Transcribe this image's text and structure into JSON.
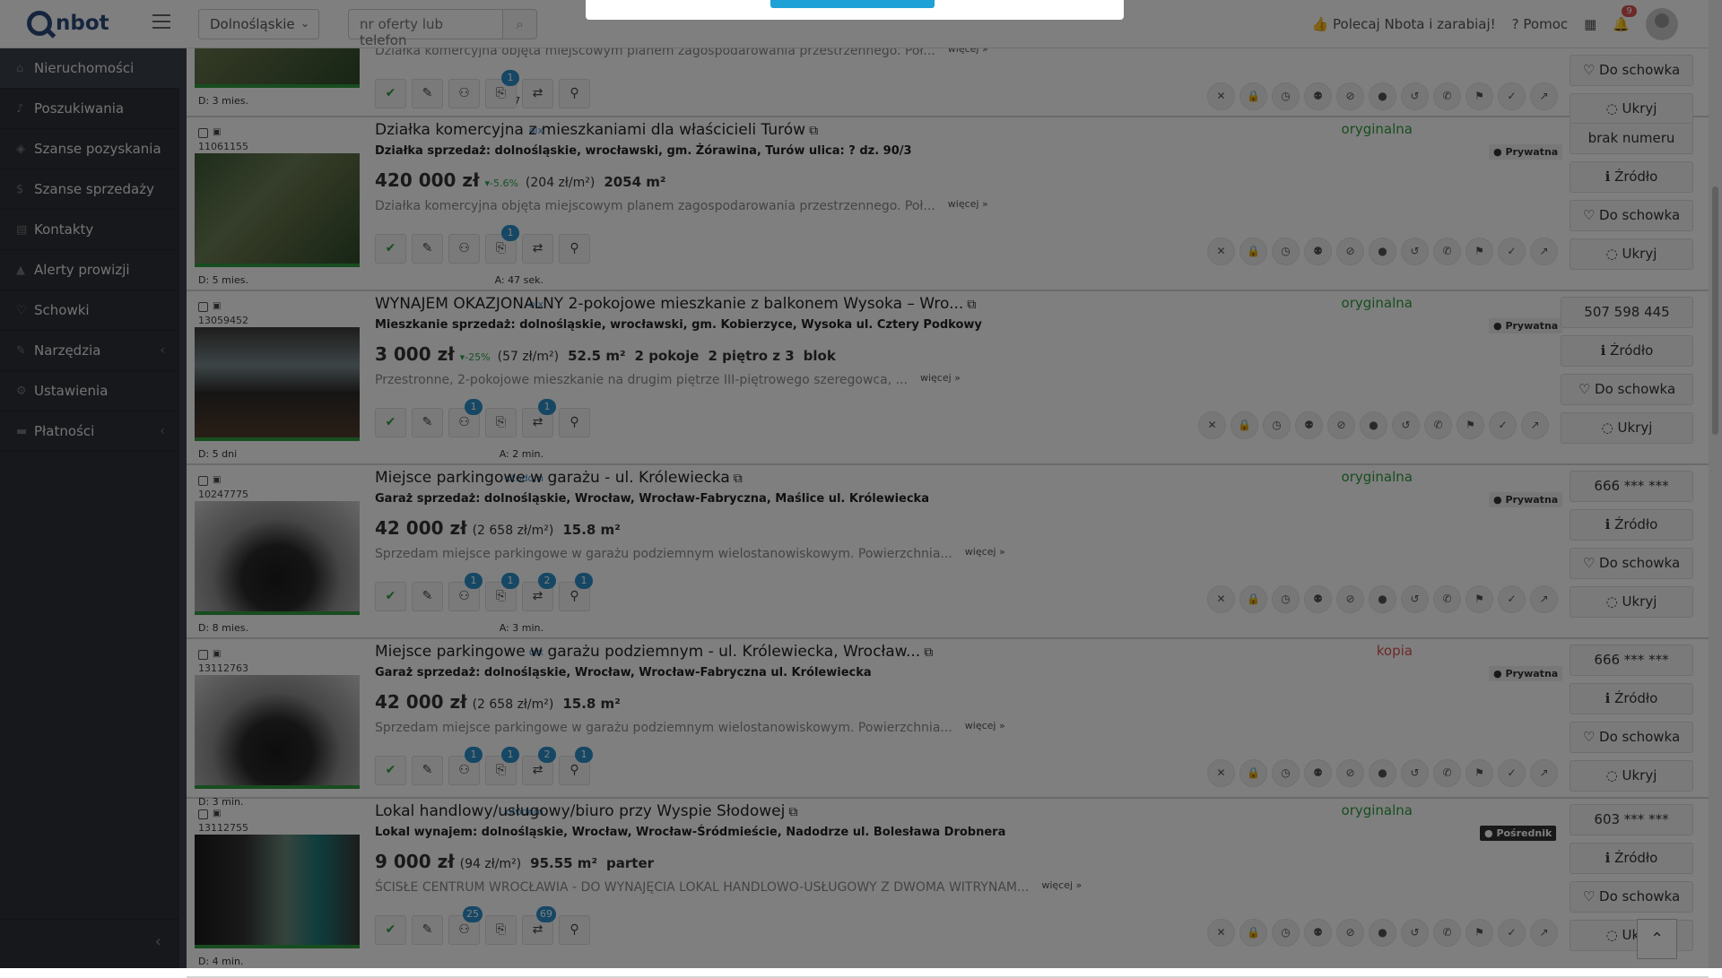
{
  "topbar": {
    "logo": "nbot",
    "region": "Dolnośląskie",
    "search_placeholder": "nr oferty lub telefon",
    "recommend": "Polecaj Nbota i zarabiaj!",
    "help": "Pomoc",
    "notifications": "9"
  },
  "sidebar": {
    "items": [
      {
        "label": "Nieruchomości",
        "icon": "home-icon"
      },
      {
        "label": "Poszukiwania",
        "icon": "bell-icon"
      },
      {
        "label": "Szanse pozyskania",
        "icon": "handshake-icon"
      },
      {
        "label": "Szanse sprzedaży",
        "icon": "dollar-icon"
      },
      {
        "label": "Kontakty",
        "icon": "contact-icon"
      },
      {
        "label": "Alerty prowizji",
        "icon": "warning-icon"
      },
      {
        "label": "Schowki",
        "icon": "heart-icon"
      },
      {
        "label": "Narzędzia",
        "icon": "wrench-icon"
      },
      {
        "label": "Ustawienia",
        "icon": "gear-icon"
      },
      {
        "label": "Płatności",
        "icon": "cart-icon"
      }
    ]
  },
  "common": {
    "source_btn": "Źródło",
    "clipboard_btn": "Do schowka",
    "hide_btn": "Ukryj",
    "more": "więcej »",
    "private": "Prywatna",
    "agent": "Pośrednik"
  },
  "listings": [
    {
      "id": "",
      "source": "",
      "age_d": "D: 3 mies.",
      "age_a": "A: 47 sek.",
      "title": "",
      "sub": "",
      "desc": "Działka komercyjna objęta miejscowym planem zagospodarowania przestrzennego. Poł...",
      "price": "",
      "change": "",
      "ppm": "",
      "area": "",
      "extra": [],
      "status": "",
      "owner": "",
      "phone": "",
      "counts": [
        "",
        "",
        "",
        "1",
        "",
        ""
      ]
    },
    {
      "id": "11061155",
      "source": "olx",
      "age_d": "D: 5 mies.",
      "age_a": "A: 47 sek.",
      "title": "Działka komercyjna z mieszkaniami dla właścicieli Turów",
      "sub": "Działka sprzedaż: dolnośląskie, wrocławski, gm. Żórawina, Turów ulica: ? dz. 90/3",
      "price": "420 000 zł",
      "change": "▾-5.6%",
      "ppm": "(204 zł/m²)",
      "area": "2054 m²",
      "extra": [],
      "desc": "Działka komercyjna objęta miejscowym planem zagospodarowania przestrzennego. Poł...",
      "status": "oryginalna",
      "owner": "Prywatna",
      "phone": "brak numeru",
      "counts": [
        "",
        "",
        "",
        "1",
        "",
        ""
      ]
    },
    {
      "id": "13059452",
      "source": "olx",
      "age_d": "D: 5 dni",
      "age_a": "A: 2 min.",
      "title": "WYNAJEM OKAZJONALNY 2-pokojowe mieszkanie z balkonem Wysoka – Wro...",
      "sub": "Mieszkanie sprzedaż: dolnośląskie, wrocławski, gm. Kobierzyce, Wysoka ul. Cztery Podkowy",
      "price": "3 000 zł",
      "change": "▾-25%",
      "ppm": "(57 zł/m²)",
      "area": "52.5 m²",
      "extra": [
        "2 pokoje",
        "2 piętro z 3",
        "blok"
      ],
      "desc": "Przestronne, 2-pokojowe mieszkanie na drugim piętrze III-piętrowego szeregowca, ...",
      "status": "oryginalna",
      "owner": "Prywatna",
      "phone": "507 598 445",
      "counts": [
        "",
        "",
        "1",
        "",
        "1",
        ""
      ]
    },
    {
      "id": "10247775",
      "source": "otodom",
      "age_d": "D: 8 mies.",
      "age_a": "A: 3 min.",
      "title": "Miejsce parkingowe w garażu - ul. Królewiecka",
      "sub": "Garaż sprzedaż: dolnośląskie, Wrocław, Wrocław-Fabryczna, Maślice ul. Królewiecka",
      "price": "42 000 zł",
      "change": "",
      "ppm": "(2 658 zł/m²)",
      "area": "15.8 m²",
      "extra": [],
      "desc": "Sprzedam miejsce parkingowe w garażu podziemnym wielostanowiskowym. Powierzchnia...",
      "status": "oryginalna",
      "owner": "Prywatna",
      "phone": "666 *** ***",
      "counts": [
        "",
        "",
        "1",
        "1",
        "2",
        "1"
      ]
    },
    {
      "id": "13112763",
      "source": "olx",
      "age_d": "D: 3 min.",
      "age_a": "",
      "title": "Miejsce parkingowe w garażu podziemnym - ul. Królewiecka, Wrocław...",
      "sub": "Garaż sprzedaż: dolnośląskie, Wrocław, Wrocław-Fabryczna ul. Królewiecka",
      "price": "42 000 zł",
      "change": "",
      "ppm": "(2 658 zł/m²)",
      "area": "15.8 m²",
      "extra": [],
      "desc": "Sprzedam miejsce parkingowe w garażu podziemnym wielostanowiskowym. Powierzchnia...",
      "status": "kopia",
      "owner": "Prywatna",
      "phone": "666 *** ***",
      "counts": [
        "",
        "",
        "1",
        "1",
        "2",
        "1"
      ]
    },
    {
      "id": "13112755",
      "source": "otodom",
      "age_d": "D: 4 min.",
      "age_a": "",
      "title": "Lokal handlowy/usługowy/biuro przy Wyspie Słodowej",
      "sub": "Lokal wynajem: dolnośląskie, Wrocław, Wrocław-Śródmieście, Nadodrze ul. Bolesława Drobnera",
      "price": "9 000 zł",
      "change": "",
      "ppm": "(94 zł/m²)",
      "area": "95.55 m²",
      "extra": [
        "parter"
      ],
      "desc": "ŚCISŁE CENTRUM WROCŁAWIA - DO WYNAJĘCIA LOKAL HANDLOWO-USŁUGOWY Z DWOMA WITRYNAM...",
      "status": "oryginalna",
      "owner": "Pośrednik",
      "phone": "603 *** ***",
      "counts": [
        "",
        "",
        "25",
        "",
        "69",
        ""
      ]
    }
  ]
}
